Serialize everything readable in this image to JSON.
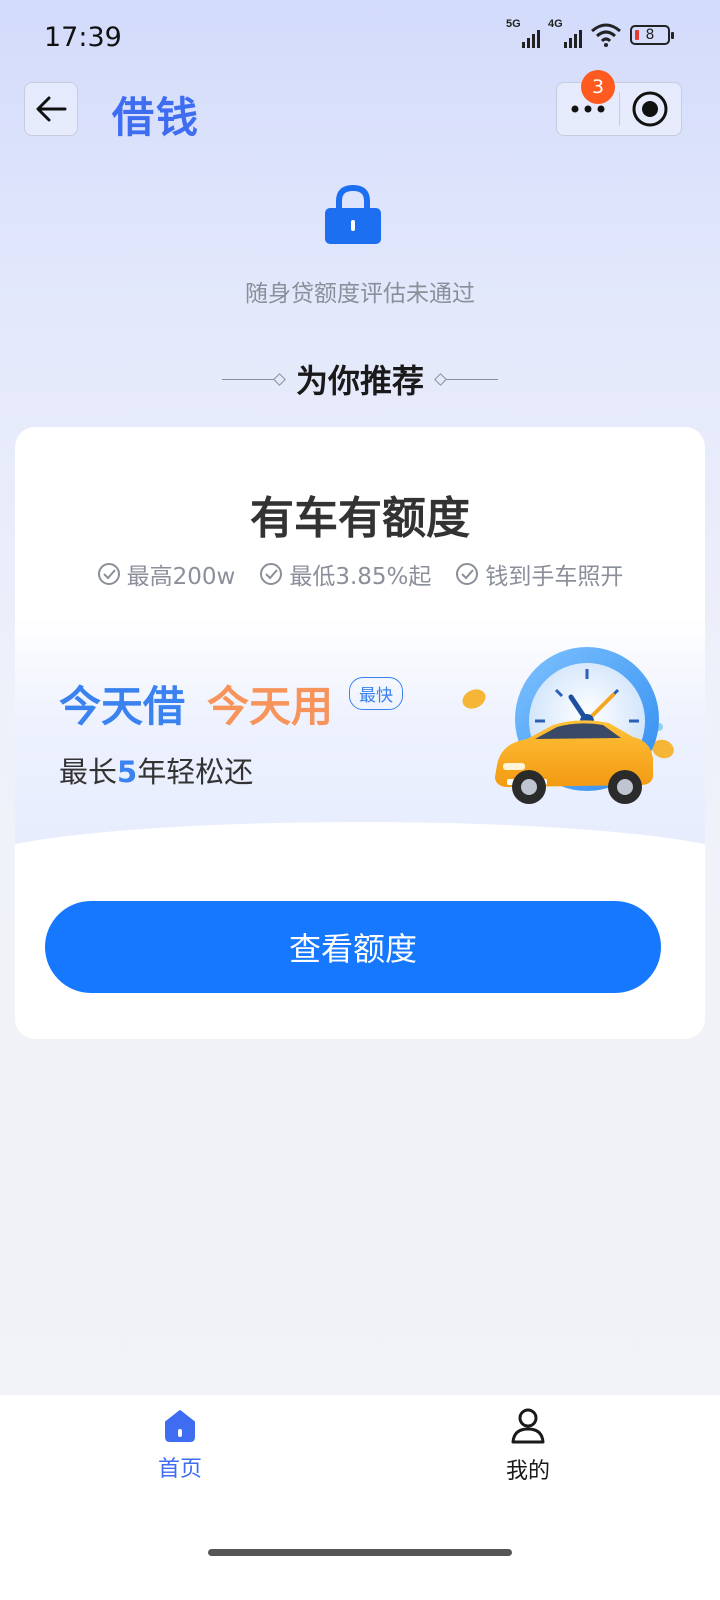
{
  "status_bar": {
    "time": "17:39",
    "signal1_label": "5G",
    "signal2_label": "4G",
    "battery_level": "8"
  },
  "nav": {
    "title": "借钱",
    "notification_count": "3",
    "icons": [
      "arrow-left-icon",
      "more-dots-icon",
      "target-circle-icon"
    ]
  },
  "assessment": {
    "icon": "lock-icon",
    "message": "随身贷额度评估未通过"
  },
  "recommend": {
    "title": "为你推荐"
  },
  "card": {
    "heading": "有车有额度",
    "features": [
      "最高200w",
      "最低3.85%起",
      "钱到手车照开"
    ],
    "promo_blue": "今天借",
    "promo_orange": "今天用",
    "fast_tag": "最快",
    "repay_prefix": "最长",
    "repay_highlight": "5",
    "repay_suffix": "年轻松还",
    "cta_label": "查看额度",
    "colors": {
      "accent_blue": "#1677ff",
      "promo_orange": "#f7945c"
    }
  },
  "tabbar": {
    "items": [
      {
        "label": "首页",
        "icon": "home-icon",
        "active": true
      },
      {
        "label": "我的",
        "icon": "user-icon",
        "active": false
      }
    ]
  }
}
